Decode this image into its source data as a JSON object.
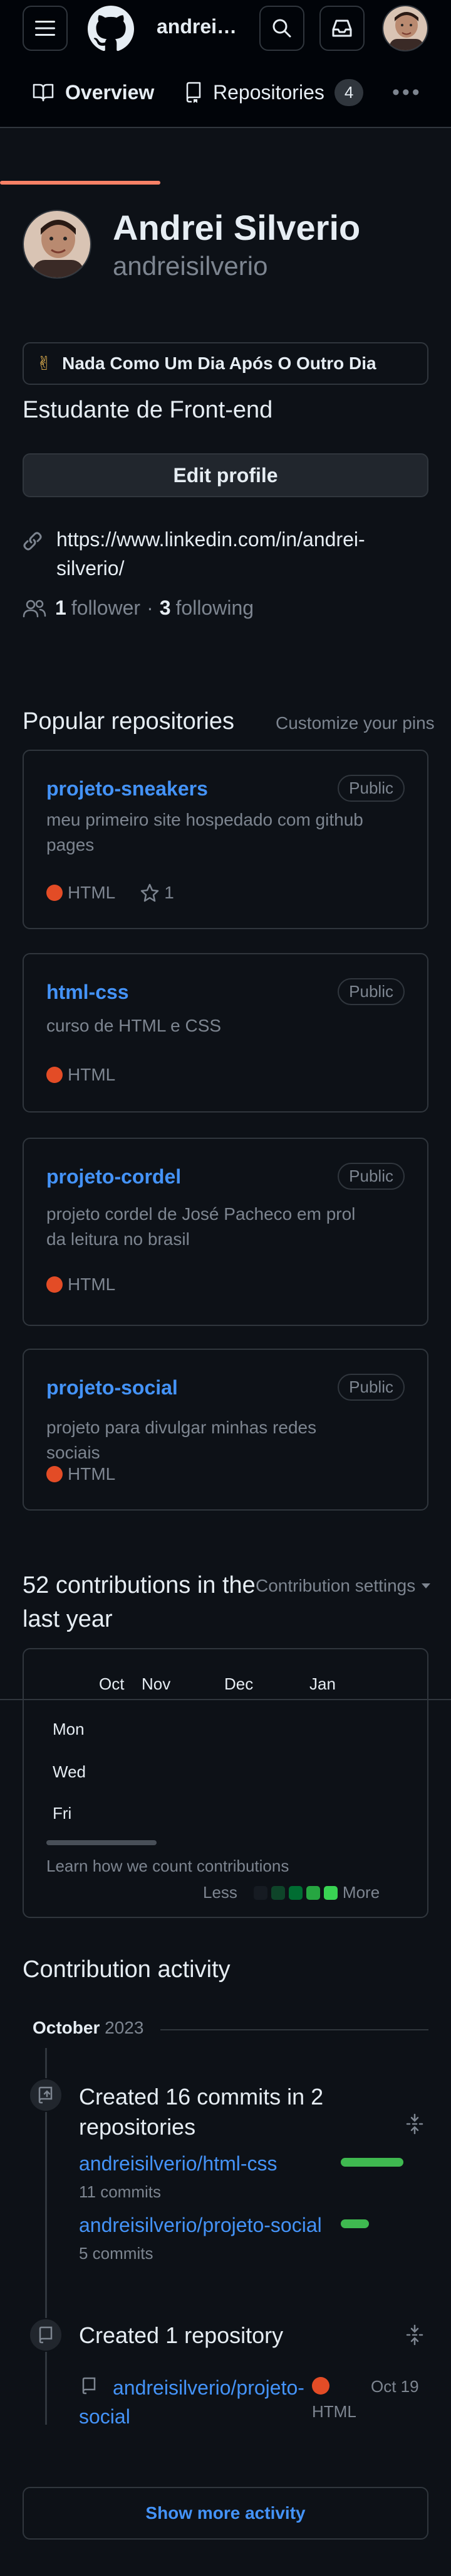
{
  "header": {
    "username_short": "andrei…",
    "menu_icon": "hamburger-icon",
    "logo_icon": "github-mark-icon",
    "search_icon": "search-icon",
    "inbox_icon": "inbox-icon"
  },
  "tabs": [
    {
      "label": "Overview",
      "icon": "book-icon",
      "active": true
    },
    {
      "label": "Repositories",
      "icon": "repo-icon",
      "count": "4"
    }
  ],
  "profile": {
    "name": "Andrei Silverio",
    "login": "andreisilverio",
    "status_emoji": "✌",
    "status_text": "Nada Como Um Dia Após O Outro Dia",
    "bio": "Estudante de Front-end",
    "edit_label": "Edit profile",
    "link": "https://www.linkedin.com/in/andrei-silverio/",
    "followers": "1",
    "followers_label": "follower",
    "sep": "·",
    "following": "3",
    "following_label": "following"
  },
  "popular": {
    "title": "Popular repositories",
    "customize": "Customize your pins",
    "repos": [
      {
        "name": "projeto-sneakers",
        "badge": "Public",
        "desc": "meu primeiro site hospedado com github pages",
        "lang": "HTML",
        "stars": "1"
      },
      {
        "name": "html-css",
        "badge": "Public",
        "desc": "curso de HTML e CSS",
        "lang": "HTML"
      },
      {
        "name": "projeto-cordel",
        "badge": "Public",
        "desc": "projeto cordel de José Pacheco em prol da leitura no brasil",
        "lang": "HTML"
      },
      {
        "name": "projeto-social",
        "badge": "Public",
        "desc": "projeto para divulgar minhas redes sociais",
        "lang": "HTML"
      }
    ]
  },
  "contributions": {
    "title": "52 contributions in the last year",
    "settings": "Contribution settings",
    "months": [
      "Oct",
      "Nov",
      "Dec",
      "Jan"
    ],
    "days": [
      "Mon",
      "Wed",
      "Fri"
    ],
    "learn": "Learn how we count contributions",
    "less": "Less",
    "more": "More",
    "legend_colors": [
      "#0e4429",
      "#006d32",
      "#26a641",
      "#39d353"
    ]
  },
  "activity": {
    "title": "Contribution activity",
    "month": "October",
    "year": "2023",
    "commits_title": "Created 16 commits in 2 repositories",
    "commit_repos": [
      {
        "name": "andreisilverio/html-css",
        "count": "11 commits",
        "share": 11
      },
      {
        "name": "andreisilverio/projeto-social",
        "count": "5 commits",
        "share": 5
      }
    ],
    "created_title": "Created 1 repository",
    "created_repo": "andreisilverio/projeto-social",
    "created_lang": "HTML",
    "created_date": "Oct 19",
    "show_more": "Show more activity"
  }
}
